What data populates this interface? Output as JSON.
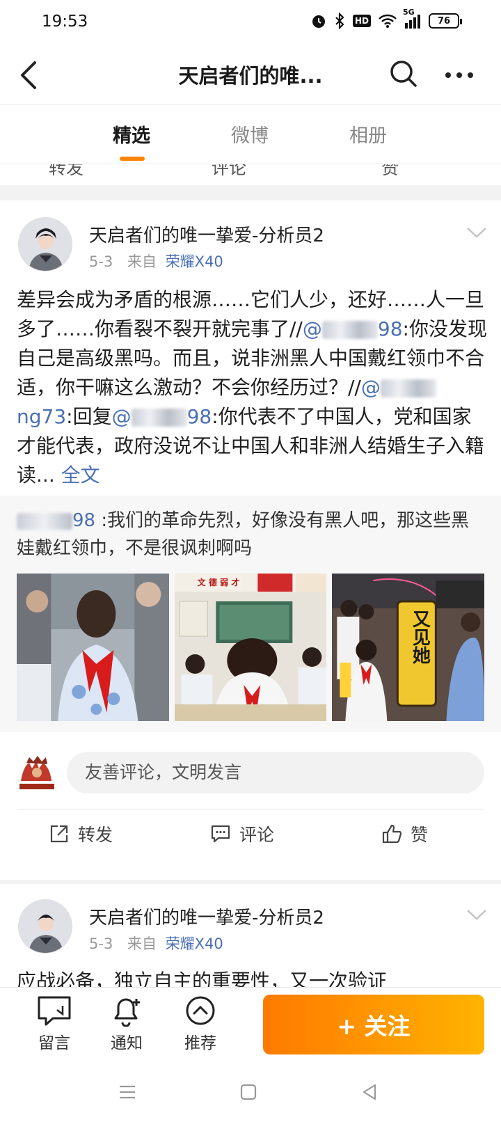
{
  "status_bar": {
    "time": "19:53",
    "network": "5G",
    "hd": "HD",
    "battery": "76",
    "icons": [
      "alarm-icon",
      "bluetooth-icon",
      "hd-icon",
      "wifi-icon",
      "signal-icon",
      "battery-icon"
    ]
  },
  "nav": {
    "title": "天启者们的唯...",
    "icons": [
      "back-icon",
      "search-icon",
      "more-icon"
    ]
  },
  "tabs": [
    {
      "label": "精选",
      "active": true
    },
    {
      "label": "微博",
      "active": false
    },
    {
      "label": "相册",
      "active": false
    }
  ],
  "partial_actions": [
    "转发",
    "评论",
    "赞"
  ],
  "posts": [
    {
      "author": "天启者们的唯一挚爱-分析员2",
      "date": "5-3",
      "from_label": "来自",
      "source": "荣耀X40",
      "text_parts": {
        "p1": "差异会成为矛盾的根源……它们人少，还好……人一旦多了……你看裂不裂开就完事了//",
        "at1": "@",
        "p2": "98",
        "p3": ":你没发现自己是高级黑吗。而且，说非洲黑人中国戴红领巾不合适，你干嘛这么激动？不会你经历过？//",
        "at2": "@",
        "at2b": "ng73",
        "p4": ":回复",
        "at3": "@",
        "at3b": "98",
        "p5": ":你代表不了中国人，党和国家才能代表，政府没说不让中国人和非洲人结婚生子入籍读",
        "ellipsis": "...",
        "full": "全文"
      },
      "quoted": {
        "handle_tail": "98",
        "text": " :我们的革命先烈，好像没有黑人吧，那这些黑娃戴红领巾，不是很讽刺啊吗",
        "photo_caption_3": "又见她",
        "classroom_sign": "文 德 弱 才"
      },
      "comment_placeholder": "友善评论，文明发言",
      "actions": {
        "repost": "转发",
        "comment": "评论",
        "like": "赞"
      }
    },
    {
      "author": "天启者们的唯一挚爱-分析员2",
      "date": "5-3",
      "from_label": "来自",
      "source": "荣耀X40",
      "text_start": "应战必备，独立自主的重要性，又一次验证"
    }
  ],
  "bottom_bar": {
    "message": "留言",
    "notify": "通知",
    "recommend": "推荐",
    "follow": "+ 关注"
  },
  "colors": {
    "accent": "#ff8200",
    "link": "#4a6fb5"
  }
}
